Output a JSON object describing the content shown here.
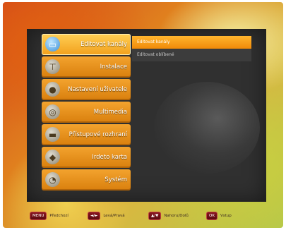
{
  "menu": {
    "items": [
      {
        "label": "Editovat kanály",
        "icon": "tv-icon"
      },
      {
        "label": "Instalace",
        "icon": "antenna-icon"
      },
      {
        "label": "Nastavení uživatele",
        "icon": "user-icon"
      },
      {
        "label": "Multimedia",
        "icon": "media-icon"
      },
      {
        "label": "Přístupové rozhraní",
        "icon": "card-slot-icon"
      },
      {
        "label": "Irdeto karta",
        "icon": "smartcard-icon"
      },
      {
        "label": "Systém",
        "icon": "gauge-icon"
      }
    ],
    "selected_index": 0
  },
  "submenu": {
    "items": [
      "Editovat kanály",
      "Editovat oblíbené"
    ]
  },
  "hints": [
    {
      "key": "MENU",
      "text": "Předchozí"
    },
    {
      "key": "◄/►",
      "text": "Levá/Pravá"
    },
    {
      "key": "▲/▼",
      "text": "Nahoru/Dolů"
    },
    {
      "key": "OK",
      "text": "Vstup"
    }
  ],
  "colors": {
    "accent": "#f2a01c",
    "panel": "#303030",
    "key": "#8a1620"
  }
}
